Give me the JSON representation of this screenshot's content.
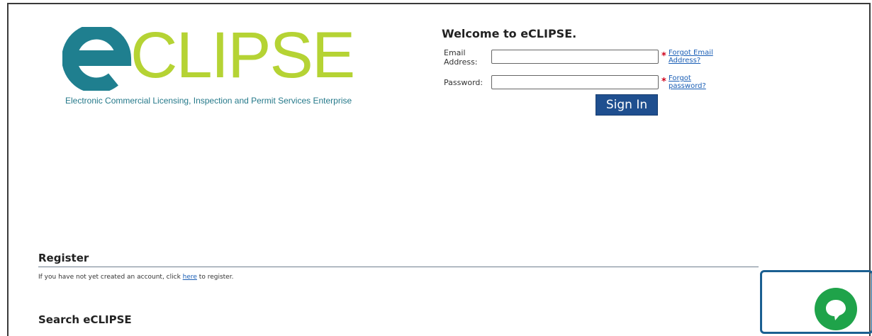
{
  "logo": {
    "word": "CLIPSE",
    "tagline": "Electronic Commercial Licensing, Inspection and Permit Services Enterprise",
    "colors": {
      "teal": "#1f7f8f",
      "lime": "#b5d334"
    }
  },
  "login": {
    "title": "Welcome to eCLIPSE.",
    "email_label_1": "Email",
    "email_label_2": "Address:",
    "email_value": "",
    "forgot_email_1": "Forgot Email",
    "forgot_email_2": "Address?",
    "password_label": "Password:",
    "password_value": "",
    "forgot_password_1": "Forgot",
    "forgot_password_2": "password?",
    "required_mark": "*",
    "signin_label": "Sign In"
  },
  "register": {
    "title": "Register",
    "text_before": "If you have not yet created an account, click ",
    "link": "here",
    "text_after": " to register."
  },
  "search": {
    "title": "Search eCLIPSE"
  },
  "chat": {
    "icon": "chat-bubble-icon",
    "color": "#1fa34a"
  }
}
